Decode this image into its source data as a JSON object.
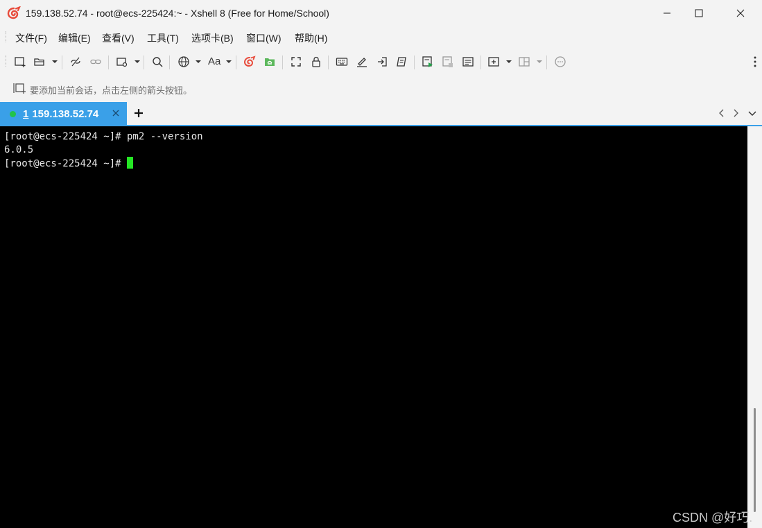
{
  "window": {
    "title": "159.138.52.74 - root@ecs-225424:~ - Xshell 8 (Free for Home/School)"
  },
  "menu": {
    "items": [
      {
        "label": "文件(F)"
      },
      {
        "label": "编辑(E)"
      },
      {
        "label": "查看(V)"
      },
      {
        "label": "工具(T)"
      },
      {
        "label": "选项卡(B)"
      },
      {
        "label": "窗口(W)"
      },
      {
        "label": "帮助(H)"
      }
    ]
  },
  "toolbar": {
    "font_label": "Aa",
    "icons": [
      "new-session-icon",
      "open-icon",
      "disconnect-icon",
      "reconnect-icon",
      "new-tab-icon",
      "search-icon",
      "globe-icon",
      "font-icon",
      "xshell-icon",
      "xftp-icon",
      "fullscreen-icon",
      "lock-icon",
      "keyboard-icon",
      "highlight-icon",
      "send-icon",
      "script-icon",
      "run-script-icon",
      "log-icon",
      "compose-icon",
      "add-icon",
      "layout-icon",
      "chat-icon"
    ]
  },
  "hint": {
    "text": "要添加当前会话，点击左侧的箭头按钮。"
  },
  "tabs": {
    "active": {
      "number": "1",
      "label": "159.138.52.74",
      "status_color": "#22c34a"
    },
    "add_label": "+"
  },
  "terminal": {
    "lines": [
      "[root@ecs-225424 ~]# pm2 --version",
      "6.0.5",
      "[root@ecs-225424 ~]#"
    ],
    "cursor_color": "#25e625"
  },
  "watermark": {
    "text": "CSDN @好巧."
  },
  "colors": {
    "accent": "#3aa0e8",
    "terminal_bg": "#000000",
    "terminal_fg": "#e8e8e8"
  }
}
